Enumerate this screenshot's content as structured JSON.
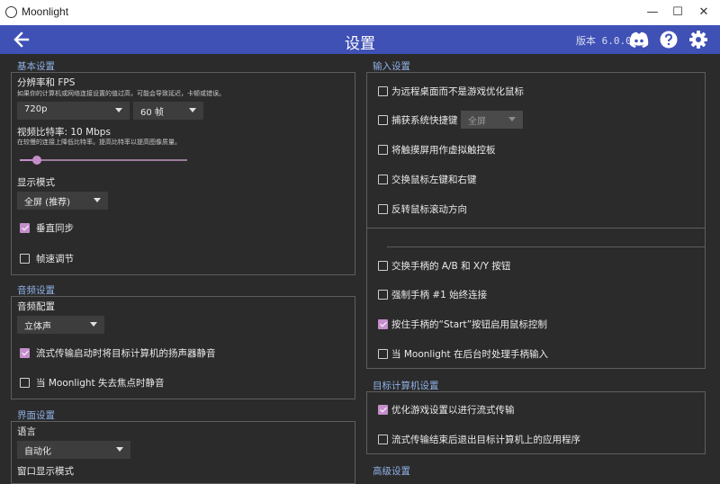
{
  "window": {
    "title": "Moonlight",
    "minimize": "—",
    "maximize": "☐",
    "close": "✕"
  },
  "header": {
    "title": "设置",
    "version": "版本 6.0.0"
  },
  "basic": {
    "section_title": "基本设置",
    "resolution_label": "分辨率和 FPS",
    "resolution_hint": "如果你的计算机或网络连接设置的值过高，可能会导致延迟，卡顿或错误。",
    "resolution_value": "720p",
    "fps_value": "60 帧",
    "bitrate_label": "视频比特率: 10 Mbps",
    "bitrate_hint": "在较慢的连接上降低比特率。提高比特率以提高图像质量。",
    "bitrate_fraction": 0.08,
    "display_mode_label": "显示模式",
    "display_mode_value": "全屏 (推荐)",
    "vsync_label": "垂直同步",
    "vsync_checked": true,
    "frame_pacing_label": "帧速调节",
    "frame_pacing_checked": false
  },
  "audio": {
    "section_title": "音频设置",
    "config_label": "音频配置",
    "config_value": "立体声",
    "mute_host_label": "流式传输启动时将目标计算机的扬声器静音",
    "mute_host_checked": true,
    "mute_unfocused_label": "当 Moonlight 失去焦点时静音",
    "mute_unfocused_checked": false
  },
  "ui": {
    "section_title": "界面设置",
    "language_label": "语言",
    "language_value": "自动化",
    "window_mode_label": "窗口显示模式"
  },
  "input": {
    "section_title": "输入设置",
    "optimize_mouse_label": "为远程桌面而不是游戏优化鼠标",
    "optimize_mouse_checked": false,
    "capture_shortcuts_label": "捕获系统快捷键",
    "capture_shortcuts_checked": false,
    "capture_shortcuts_value": "全屏",
    "touchpad_label": "将触摸屏用作虚拟触控板",
    "touchpad_checked": false,
    "swap_buttons_label": "交换鼠标左键和右键",
    "swap_buttons_checked": false,
    "reverse_scroll_label": "反转鼠标滚动方向",
    "reverse_scroll_checked": false
  },
  "gamepad": {
    "swap_ab_label": "交换手柄的 A/B 和 X/Y 按钮",
    "swap_ab_checked": false,
    "force_gamepad_label": "强制手柄 #1 始终连接",
    "force_gamepad_checked": false,
    "start_mouse_label": "按住手柄的“Start”按钮启用鼠标控制",
    "start_mouse_checked": true,
    "background_label": "当 Moonlight 在后台时处理手柄输入",
    "background_checked": false
  },
  "host": {
    "section_title": "目标计算机设置",
    "optimize_games_label": "优化游戏设置以进行流式传输",
    "optimize_games_checked": true,
    "quit_app_label": "流式传输结束后退出目标计算机上的应用程序",
    "quit_app_checked": false
  },
  "advanced": {
    "section_title": "高级设置"
  },
  "colors": {
    "header": "#3f51b5",
    "accent": "#c58ecb",
    "section_title": "#8fb0e6",
    "background": "#2b2b2b"
  },
  "icons": {
    "back": "back-arrow-icon",
    "discord": "discord-icon",
    "help": "help-icon",
    "settings": "gear-icon"
  }
}
